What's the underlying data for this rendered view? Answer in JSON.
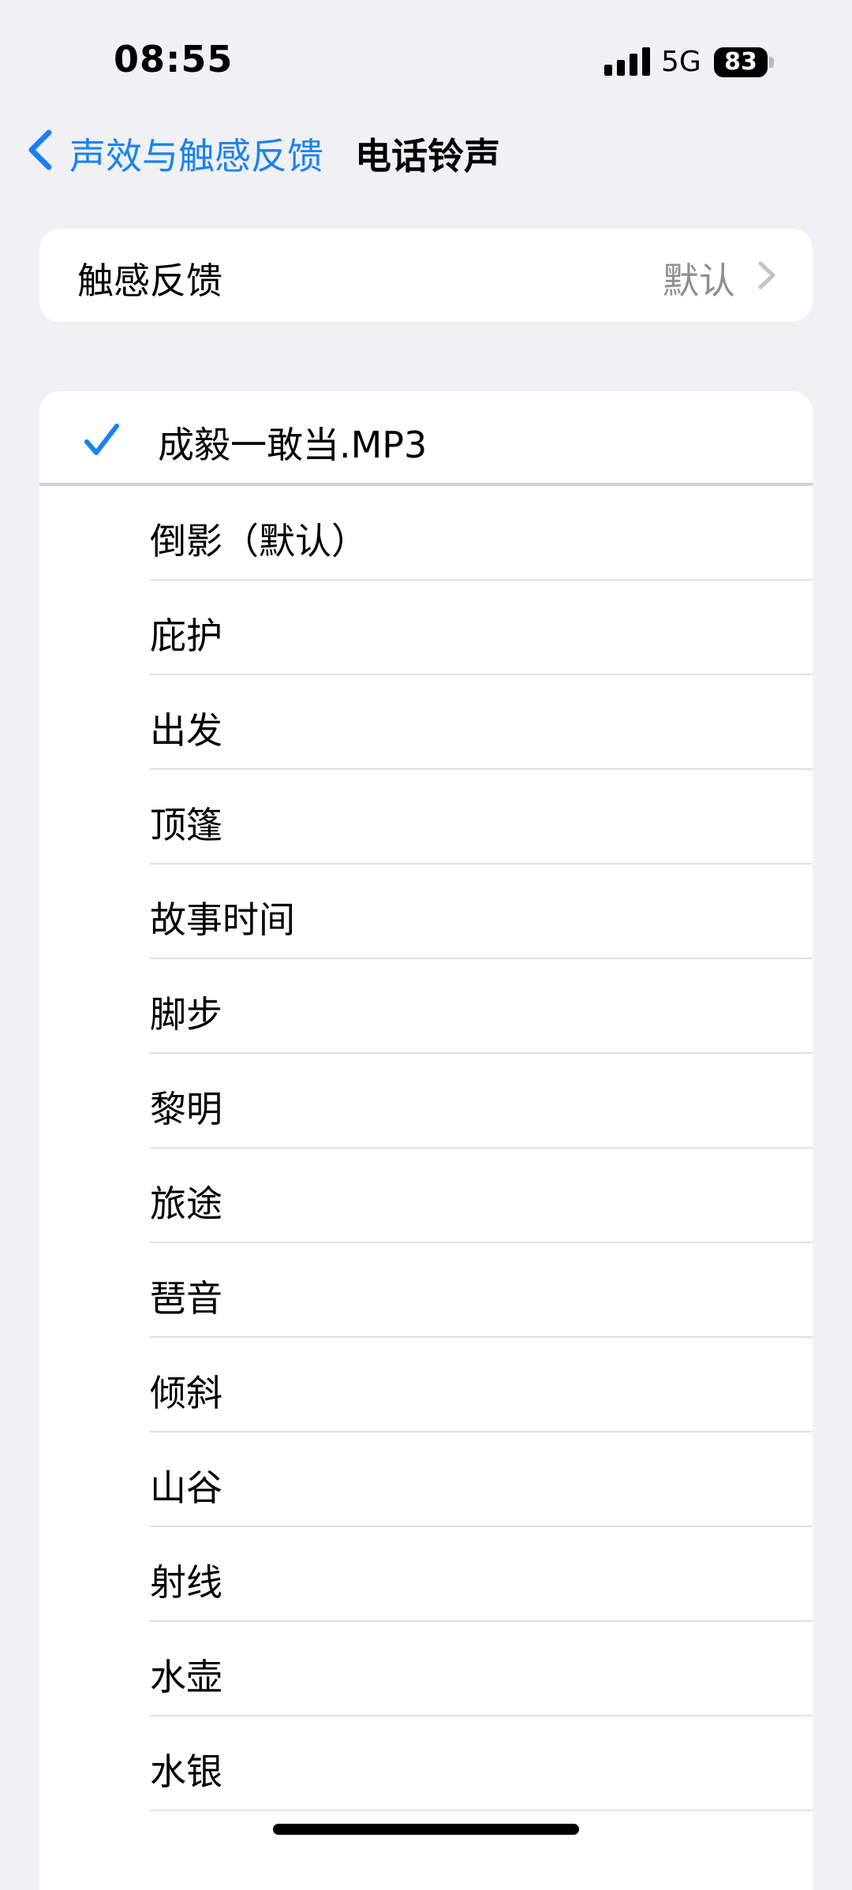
{
  "status_bar": {
    "time": "08:55",
    "network": "5G",
    "battery": "83"
  },
  "nav": {
    "back_label": "声效与触感反馈",
    "title": "电话铃声"
  },
  "haptics": {
    "label": "触感反馈",
    "value": "默认"
  },
  "ringtones": {
    "selected": "成毅一敢当.MP3",
    "items": [
      "倒影（默认）",
      "庇护",
      "出发",
      "顶篷",
      "故事时间",
      "脚步",
      "黎明",
      "旅途",
      "琶音",
      "倾斜",
      "山谷",
      "射线",
      "水壶",
      "水银"
    ]
  },
  "colors": {
    "accent": "#1a82f0",
    "background": "#f0f0f5",
    "secondary_text": "#8e8e93"
  },
  "icons": {
    "back": "chevron-left-icon",
    "disclosure": "chevron-right-icon",
    "selected": "checkmark-icon"
  }
}
